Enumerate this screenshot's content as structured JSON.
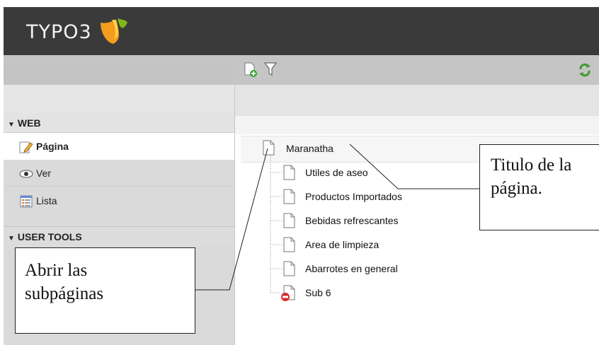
{
  "header": {
    "brand": "TYPO3"
  },
  "menu": {
    "web_section": "WEB",
    "items": [
      {
        "label": "Página",
        "icon": "page-edit-icon"
      },
      {
        "label": "Ver",
        "icon": "eye-icon"
      },
      {
        "label": "Lista",
        "icon": "list-icon"
      }
    ],
    "user_tools_section": "USER TOOLS"
  },
  "toolbar": {
    "icons": [
      "new-page-icon",
      "filter-icon",
      "refresh-icon"
    ]
  },
  "tree": {
    "root": "Maranatha",
    "children": [
      "Utiles de aseo",
      "Productos Importados",
      "Bebidas refrescantes",
      "Area de limpieza",
      "Abarrotes en general",
      "Sub 6"
    ]
  },
  "callouts": {
    "title_line1": "Titulo de la",
    "title_line2": "página.",
    "open_line1": "Abrir las",
    "open_line2": "subpáginas"
  },
  "colors": {
    "header_bg": "#3a3a3a",
    "logo_orange": "#f39c1d",
    "logo_green": "#7fb819",
    "panel_gray": "#dadada"
  }
}
